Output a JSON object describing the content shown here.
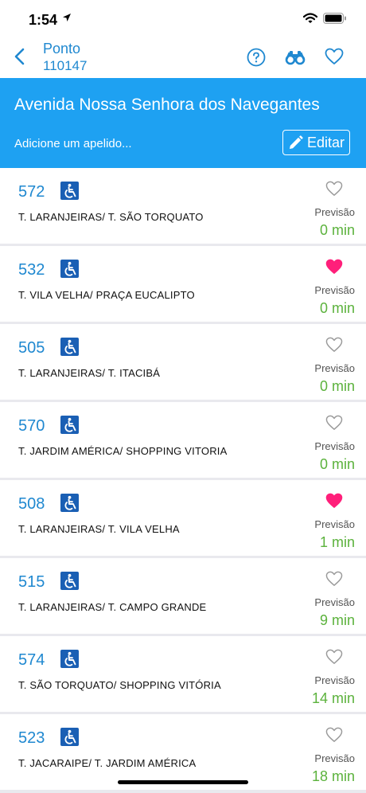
{
  "status_bar": {
    "time": "1:54"
  },
  "nav": {
    "title": "Ponto",
    "stop_code": "110147",
    "icons": [
      "back-chevron-icon",
      "help-icon",
      "binoculars-icon",
      "heart-outline-icon"
    ]
  },
  "banner": {
    "stop_name": "Avenida Nossa Senhora dos Navegantes",
    "nickname_placeholder": "Adicione um apelido...",
    "edit_label": "Editar"
  },
  "colors": {
    "accent": "#1f88d0",
    "banner": "#1ea1f2",
    "eta_green": "#5bb23c",
    "favorite_pink": "#ff1f7a",
    "heart_outline": "#9a9a9a"
  },
  "routes": [
    {
      "number": "572",
      "description": "T. LARANJEIRAS/ T. SÃO TORQUATO",
      "forecast_label": "Previsão",
      "forecast": "0 min",
      "favorite": false
    },
    {
      "number": "532",
      "description": "T. VILA VELHA/ PRAÇA EUCALIPTO",
      "forecast_label": "Previsão",
      "forecast": "0 min",
      "favorite": true
    },
    {
      "number": "505",
      "description": "T. LARANJEIRAS/ T. ITACIBÁ",
      "forecast_label": "Previsão",
      "forecast": "0 min",
      "favorite": false
    },
    {
      "number": "570",
      "description": "T. JARDIM AMÉRICA/ SHOPPING VITORIA",
      "forecast_label": "Previsão",
      "forecast": "0 min",
      "favorite": false
    },
    {
      "number": "508",
      "description": "T. LARANJEIRAS/ T. VILA VELHA",
      "forecast_label": "Previsão",
      "forecast": "1 min",
      "favorite": true
    },
    {
      "number": "515",
      "description": "T. LARANJEIRAS/ T. CAMPO GRANDE",
      "forecast_label": "Previsão",
      "forecast": "9 min",
      "favorite": false
    },
    {
      "number": "574",
      "description": "T. SÃO TORQUATO/ SHOPPING VITÓRIA",
      "forecast_label": "Previsão",
      "forecast": "14 min",
      "favorite": false
    },
    {
      "number": "523",
      "description": "T. JACARAIPE/ T. JARDIM AMÉRICA",
      "forecast_label": "Previsão",
      "forecast": "18 min",
      "favorite": false
    }
  ]
}
